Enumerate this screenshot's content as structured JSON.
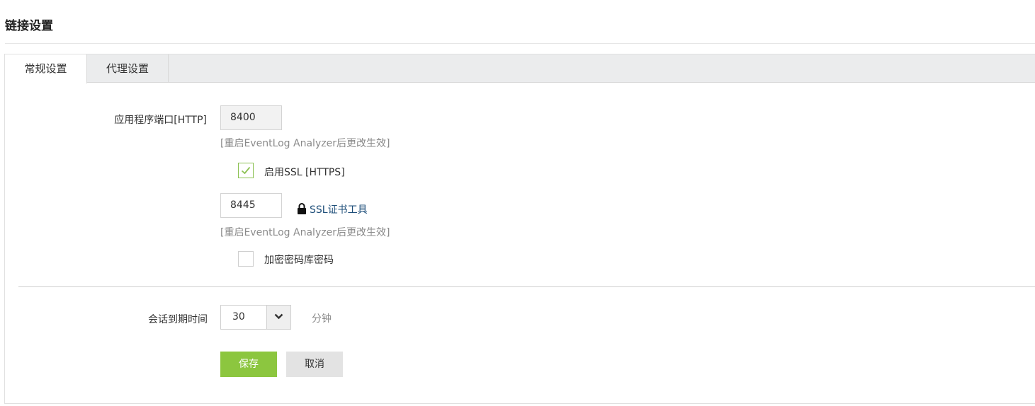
{
  "page": {
    "title": "链接设置"
  },
  "tabs": [
    {
      "label": "常规设置",
      "active": true
    },
    {
      "label": "代理设置",
      "active": false
    }
  ],
  "http": {
    "label": "应用程序端口[HTTP]",
    "value": "8400",
    "hint": "[重启EventLog Analyzer后更改生效]"
  },
  "ssl": {
    "enable_label": "启用SSL [HTTPS]",
    "enabled": true,
    "port_value": "8445",
    "tool_link": "SSL证书工具",
    "hint": "[重启EventLog Analyzer后更改生效]"
  },
  "encrypt": {
    "label": "加密密码库密码",
    "checked": false
  },
  "session": {
    "label": "会话到期时间",
    "value": "30",
    "unit": "分钟"
  },
  "buttons": {
    "save": "保存",
    "cancel": "取消"
  },
  "colors": {
    "accent": "#8cc63f",
    "link": "#1f4f7a"
  },
  "icons": {
    "ssl_tool": "lock-icon",
    "checkbox_check": "check-icon",
    "dropdown": "chevron-down-icon"
  }
}
